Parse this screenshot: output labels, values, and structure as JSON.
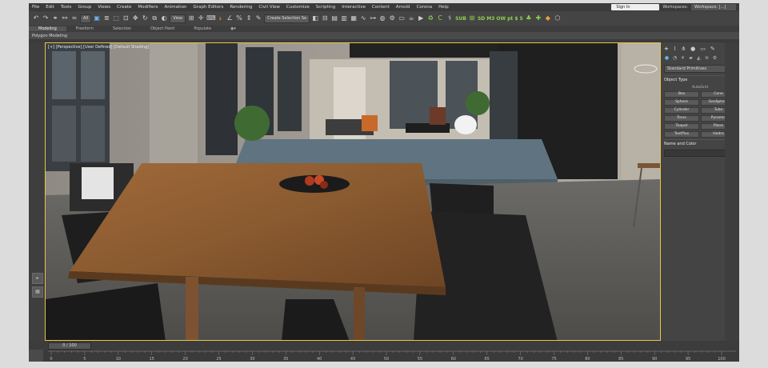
{
  "menubar": {
    "items": [
      "File",
      "Edit",
      "Tools",
      "Group",
      "Views",
      "Create",
      "Modifiers",
      "Animation",
      "Graph Editors",
      "Rendering",
      "Civil View",
      "Customize",
      "Scripting",
      "Interactive",
      "Content",
      "Arnold",
      "Corona",
      "Help"
    ],
    "sign_in": "Sign In",
    "workspaces_label": "Workspaces:",
    "workspace_value": "Workspace: [...]"
  },
  "toolbar": {
    "filter_value": "All",
    "view_value": "View",
    "selection_set_value": "Create Selection Se",
    "plugin_labels": [
      "SUB",
      "SD",
      "M3",
      "OW",
      "pt",
      "$",
      "S"
    ]
  },
  "ribbon": {
    "tabs": [
      "Modeling",
      "Freeform",
      "Selection",
      "Object Paint",
      "Populate"
    ],
    "active_tab": "Modeling",
    "panel_label": "Polygon Modeling"
  },
  "viewport": {
    "label": "[+] [Perspective] [User Defined] [Default Shading]"
  },
  "command_panel": {
    "category": "Standard Primitives",
    "object_type_title": "Object Type",
    "autogrid_label": "AutoGrid",
    "primitives": [
      "Box",
      "Cone",
      "Sphere",
      "GeoSphere",
      "Cylinder",
      "Tube",
      "Torus",
      "Pyramid",
      "Teapot",
      "Plane",
      "TextPlus",
      "Hedra"
    ],
    "name_color_title": "Name and Color",
    "swatch_color": "#e0457a"
  },
  "timeline": {
    "frame_readout": "0 / 100",
    "ticks": [
      "0",
      "5",
      "10",
      "15",
      "20",
      "25",
      "30",
      "35",
      "40",
      "45",
      "50",
      "55",
      "60",
      "65",
      "70",
      "75",
      "80",
      "85",
      "90",
      "95",
      "100"
    ]
  },
  "colors": {
    "viewport_border": "#e6c54a",
    "accent": "#5fb6ff"
  }
}
